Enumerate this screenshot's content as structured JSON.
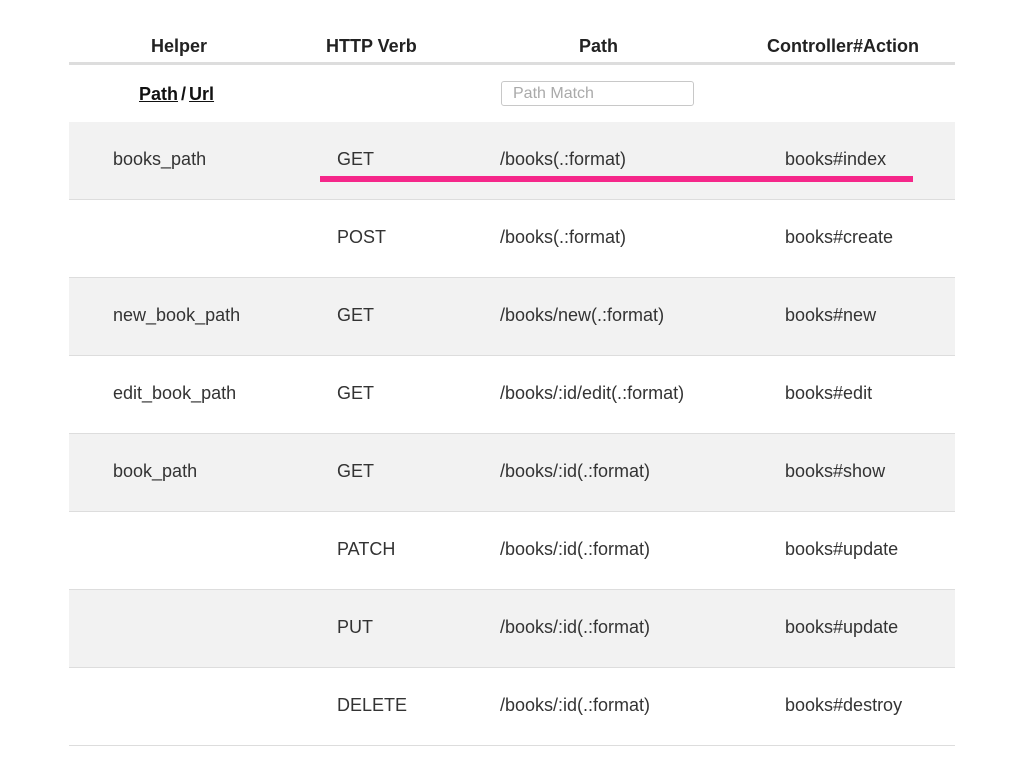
{
  "header": {
    "helper": "Helper",
    "verb": "HTTP Verb",
    "path": "Path",
    "action": "Controller#Action"
  },
  "filter": {
    "path_link": "Path",
    "separator": "/",
    "url_link": "Url",
    "search_placeholder": "Path Match",
    "search_value": ""
  },
  "highlight_color": "#f5278a",
  "routes": [
    {
      "helper": "books_path",
      "verb": "GET",
      "path": "/books(.:format)",
      "action": "books#index"
    },
    {
      "helper": "",
      "verb": "POST",
      "path": "/books(.:format)",
      "action": "books#create"
    },
    {
      "helper": "new_book_path",
      "verb": "GET",
      "path": "/books/new(.:format)",
      "action": "books#new"
    },
    {
      "helper": "edit_book_path",
      "verb": "GET",
      "path": "/books/:id/edit(.:format)",
      "action": "books#edit"
    },
    {
      "helper": "book_path",
      "verb": "GET",
      "path": "/books/:id(.:format)",
      "action": "books#show"
    },
    {
      "helper": "",
      "verb": "PATCH",
      "path": "/books/:id(.:format)",
      "action": "books#update"
    },
    {
      "helper": "",
      "verb": "PUT",
      "path": "/books/:id(.:format)",
      "action": "books#update"
    },
    {
      "helper": "",
      "verb": "DELETE",
      "path": "/books/:id(.:format)",
      "action": "books#destroy"
    }
  ]
}
